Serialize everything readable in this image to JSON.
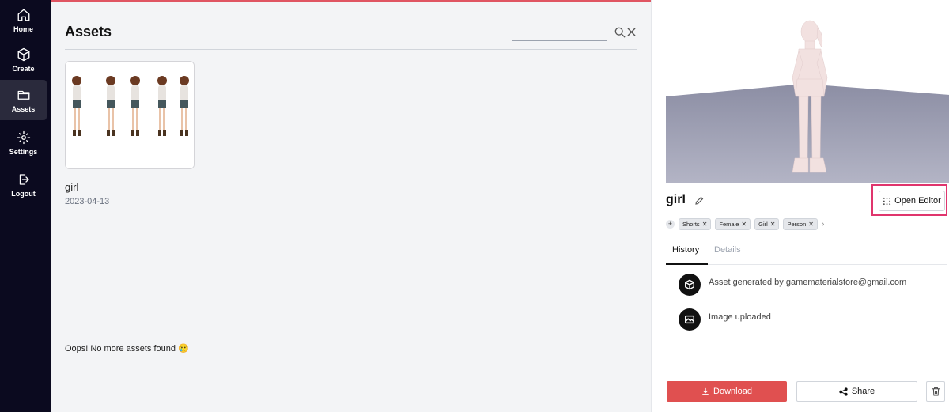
{
  "sidebar": {
    "items": [
      {
        "label": "Home",
        "icon": "home-icon"
      },
      {
        "label": "Create",
        "icon": "cube-icon"
      },
      {
        "label": "Assets",
        "icon": "folder-icon",
        "active": true
      },
      {
        "label": "Settings",
        "icon": "gear-icon"
      },
      {
        "label": "Logout",
        "icon": "logout-icon"
      }
    ]
  },
  "main": {
    "title": "Assets",
    "search": {
      "placeholder": "",
      "value": ""
    },
    "assets": [
      {
        "name": "girl",
        "date": "2023-04-13"
      }
    ],
    "empty_message": "Oops! No more assets found 😢"
  },
  "detail": {
    "name": "girl",
    "open_editor_label": "Open Editor",
    "tags": [
      "Shorts",
      "Female",
      "Girl",
      "Person"
    ],
    "tabs": [
      {
        "label": "History",
        "active": true
      },
      {
        "label": "Details",
        "active": false
      }
    ],
    "history": [
      {
        "icon": "cube-icon",
        "text": "Asset generated by gamematerialstore@gmail.com"
      },
      {
        "icon": "image-icon",
        "text": "Image uploaded"
      }
    ],
    "download_label": "Download",
    "share_label": "Share"
  },
  "colors": {
    "sidebar_bg": "#0b0a1f",
    "accent_red": "#e05050",
    "highlight_pink": "#e0356d",
    "preview_floor": "#9a9cb0"
  }
}
